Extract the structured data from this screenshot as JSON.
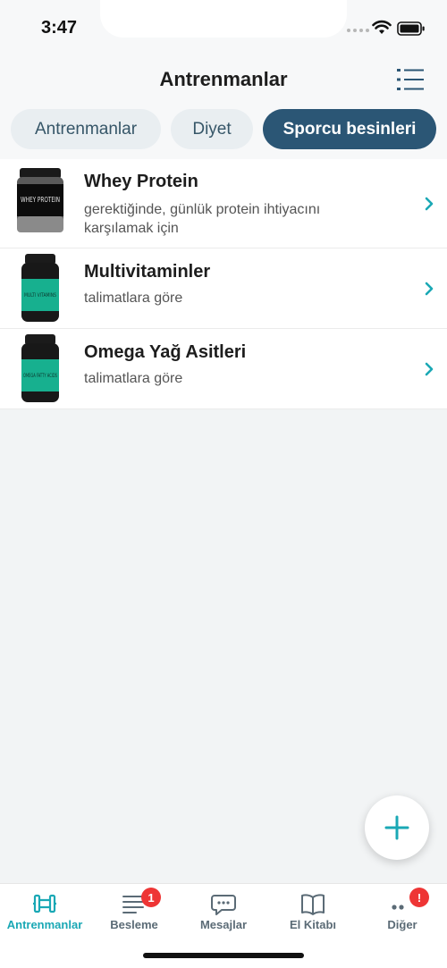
{
  "status_bar": {
    "time": "3:47"
  },
  "header": {
    "title": "Antrenmanlar"
  },
  "tabs": [
    {
      "label": "Antrenmanlar",
      "active": false
    },
    {
      "label": "Diyet",
      "active": false
    },
    {
      "label": "Sporcu besinleri",
      "active": true
    }
  ],
  "supplements": [
    {
      "title": "Whey Protein",
      "description": "gerektiğinde, günlük protein ihtiyacını karşılamak için",
      "image_label": "WHEY PROTEIN"
    },
    {
      "title": "Multivitaminler",
      "description": "talimatlara göre",
      "image_label": "MULTI VITAMINS"
    },
    {
      "title": "Omega Yağ Asitleri",
      "description": "talimatlara göre",
      "image_label": "OMEGA FATTY ACIDS"
    }
  ],
  "tab_bar": {
    "items": [
      {
        "label": "Antrenmanlar",
        "icon": "dumbbell-icon",
        "active": true
      },
      {
        "label": "Besleme",
        "icon": "list-icon",
        "badge": "1"
      },
      {
        "label": "Mesajlar",
        "icon": "chat-bubble-icon"
      },
      {
        "label": "El Kitabı",
        "icon": "book-icon"
      },
      {
        "label": "Diğer",
        "icon": "more-dots-icon",
        "badge": "!"
      }
    ]
  },
  "colors": {
    "accent": "#1aa8b5",
    "active_tab": "#2b5675",
    "badge": "#ee3535"
  }
}
